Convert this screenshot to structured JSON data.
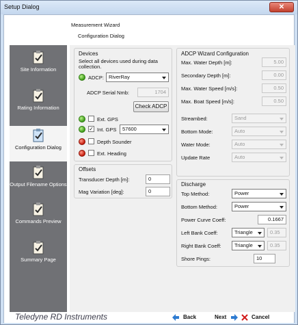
{
  "window": {
    "title": "Setup Dialog"
  },
  "header": {
    "wizard": "Measurement Wizard",
    "subtitle": "Configuration Dialog"
  },
  "sidebar": {
    "items": [
      {
        "label": "Site Information"
      },
      {
        "label": "Rating Information"
      },
      {
        "label": "Configuration Dialog"
      },
      {
        "label": "Output Filename Options"
      },
      {
        "label": "Commands Preview"
      },
      {
        "label": "Summary Page"
      }
    ]
  },
  "devices": {
    "title": "Devices",
    "instructions": "Select all devices used during data collection.",
    "adcp_label": "ADCP:",
    "adcp_value": "RiverRay",
    "serial_label": "ADCP Serial Nmb:",
    "serial_value": "1704",
    "check_button": "Check ADCP",
    "ext_gps": "Ext. GPS",
    "int_gps": "Int. GPS",
    "int_gps_baud": "57600",
    "depth_sounder": "Depth Sounder",
    "ext_heading": "Ext. Heading"
  },
  "offsets": {
    "title": "Offsets",
    "transducer_label": "Transducer Depth [m]:",
    "transducer_value": "0",
    "magvar_label": "Mag Variation [deg]:",
    "magvar_value": "0"
  },
  "wizard_config": {
    "title": "ADCP Wizard Configuration",
    "max_water_depth_label": "Max. Water Depth [m]:",
    "max_water_depth_value": "5.00",
    "secondary_depth_label": "Secondary Depth [m]:",
    "secondary_depth_value": "0.00",
    "max_water_speed_label": "Max. Water Speed [m/s]:",
    "max_water_speed_value": "0.50",
    "max_boat_speed_label": "Max. Boat Speed [m/s]:",
    "max_boat_speed_value": "0.50",
    "streambed_label": "Streambed:",
    "streambed_value": "Sand",
    "bottom_mode_label": "Bottom Mode:",
    "bottom_mode_value": "Auto",
    "water_mode_label": "Water Mode:",
    "water_mode_value": "Auto",
    "update_rate_label": "Update Rate",
    "update_rate_value": "Auto"
  },
  "discharge": {
    "title": "Discharge",
    "top_method_label": "Top Method:",
    "top_method_value": "Power",
    "bottom_method_label": "Bottom Method:",
    "bottom_method_value": "Power",
    "power_curve_label": "Power Curve Coeff:",
    "power_curve_value": "0.1667",
    "left_bank_label": "Left Bank Coeff:",
    "left_bank_shape": "Triangle",
    "left_bank_value": "0.35",
    "right_bank_label": "Right Bank Coeff:",
    "right_bank_shape": "Triangle",
    "right_bank_value": "0.35",
    "shore_pings_label": "Shore Pings:",
    "shore_pings_value": "10"
  },
  "footer": {
    "brand": "Teledyne RD Instruments",
    "back": "Back",
    "next": "Next",
    "cancel": "Cancel"
  },
  "colors": {
    "sidebar": "#707175",
    "panel": "#f0f0f0",
    "title": "#cfe0f3"
  }
}
